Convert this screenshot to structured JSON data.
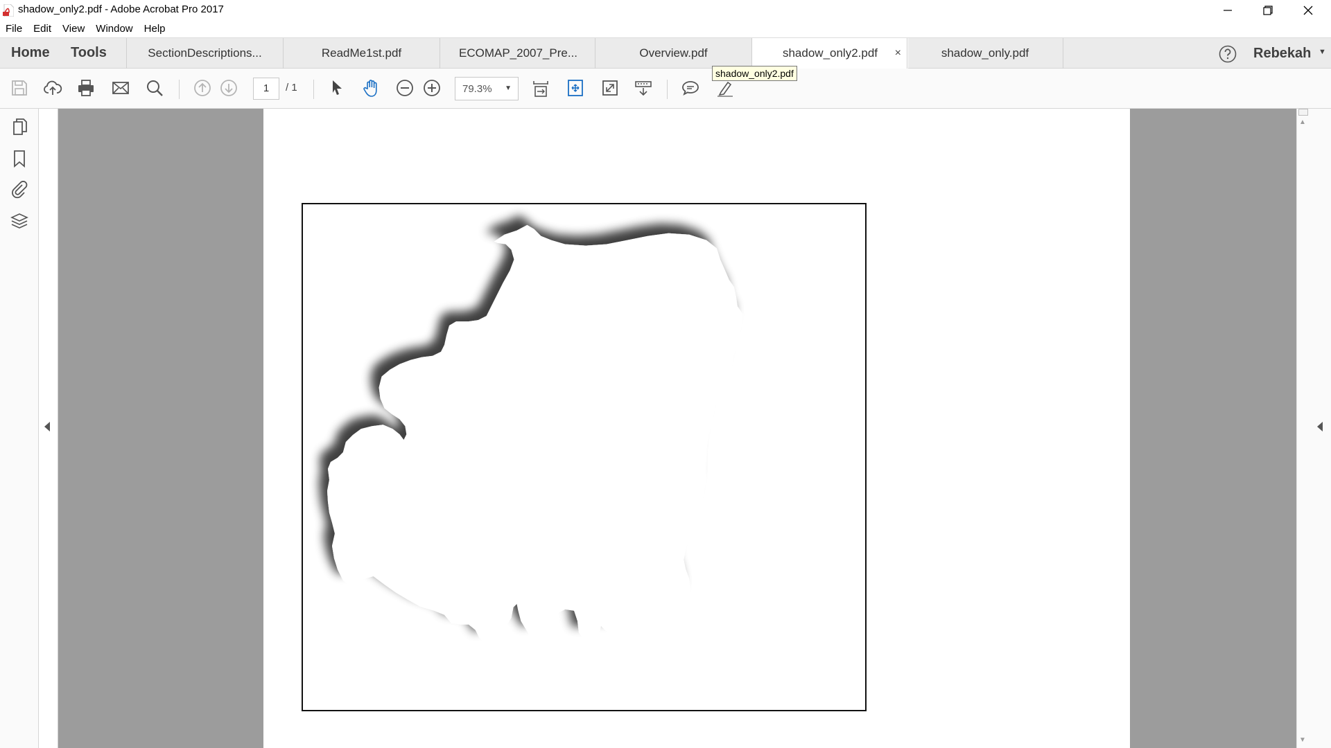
{
  "window": {
    "title": "shadow_only2.pdf - Adobe Acrobat Pro 2017",
    "app_icon": "acrobat-pdf-icon",
    "controls": [
      "minimize-icon",
      "restore-icon",
      "close-icon"
    ]
  },
  "menu": {
    "items": [
      "File",
      "Edit",
      "View",
      "Window",
      "Help"
    ]
  },
  "tabs": {
    "home": "Home",
    "tools": "Tools",
    "documents": [
      {
        "label": "SectionDescriptions..."
      },
      {
        "label": "ReadMe1st.pdf"
      },
      {
        "label": "ECOMAP_2007_Pre..."
      },
      {
        "label": "Overview.pdf"
      },
      {
        "label": "shadow_only2.pdf",
        "active": true,
        "close": "×"
      },
      {
        "label": "shadow_only.pdf"
      }
    ],
    "user": "Rebekah"
  },
  "toolbar": {
    "current_page": "1",
    "total_pages": "/ 1",
    "zoom": "79.3%",
    "tooltip": "shadow_only2.pdf",
    "icons": [
      "save-icon",
      "upload-icon",
      "print-icon",
      "email-icon",
      "search-icon",
      "prev-page-icon",
      "next-page-icon",
      "select-cursor-icon",
      "hand-icon",
      "zoom-out-icon",
      "zoom-in-icon",
      "page-fit-icon",
      "fit-width-icon",
      "full-screen-icon",
      "read-mode-icon",
      "comment-icon",
      "highlight-icon"
    ]
  },
  "left_rail": {
    "icons": [
      "page-thumbnails-icon",
      "bookmark-icon",
      "attachment-icon",
      "layers-icon"
    ]
  },
  "colors": {
    "doc_background": "#9c9c9c",
    "tab_bar": "#ebebeb",
    "accent_blue": "#1a6fc4",
    "tooltip_bg": "#ffffe1"
  }
}
